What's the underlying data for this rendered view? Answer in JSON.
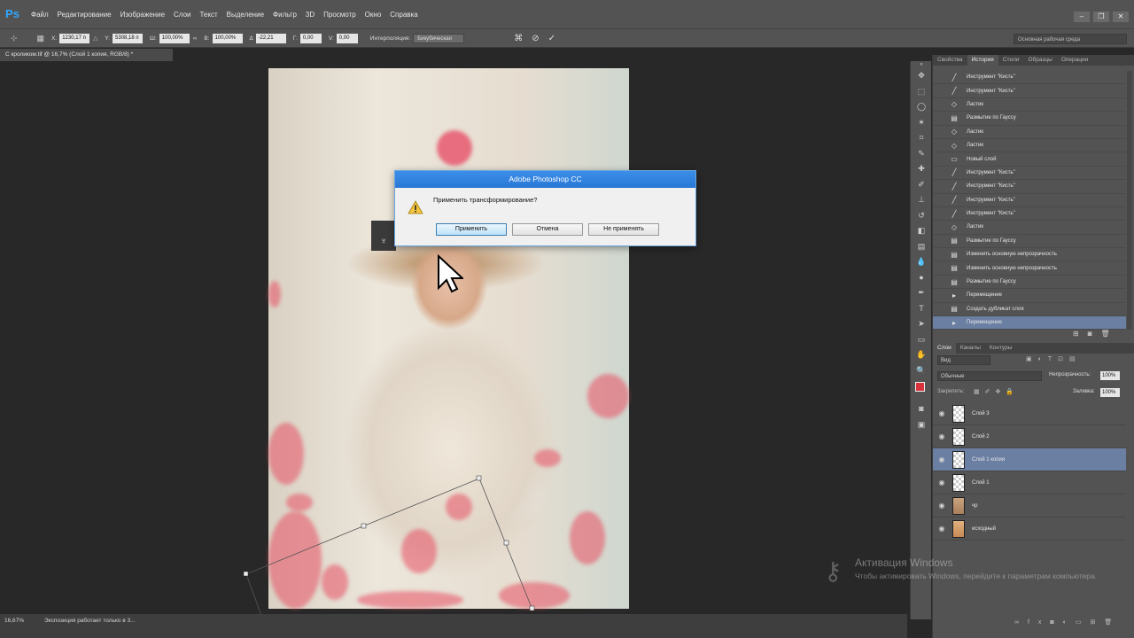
{
  "app": {
    "logo": "Ps",
    "workspace": "Основная рабочая среда"
  },
  "menu": [
    "Файл",
    "Редактирование",
    "Изображение",
    "Слои",
    "Текст",
    "Выделение",
    "Фильтр",
    "3D",
    "Просмотр",
    "Окно",
    "Справка"
  ],
  "options": {
    "x_label": "X:",
    "x_value": "1230,17 п",
    "y_label": "Y:",
    "y_value": "5308,18 п",
    "w_label": "Ш:",
    "w_value": "100,00%",
    "h_label": "В:",
    "h_value": "100,00%",
    "angle_label": "∆",
    "angle_value": "-22,21",
    "hskew_label": "Г:",
    "hskew_value": "0,00",
    "vskew_label": "V:",
    "vskew_value": "0,00",
    "interp_label": "Интерполяция:",
    "interp_value": "Бикубическая"
  },
  "document_tab": "С кроликом.tif @ 16,7% (Слой 1 копия, RGB/8) *",
  "dialog": {
    "title": "Adobe Photoshop CC",
    "message": "Применить трансформирование?",
    "apply": "Применить",
    "cancel": "Отмена",
    "dont_apply": "Не применять"
  },
  "panel_tabs_top": [
    "Свойства",
    "История",
    "Стили",
    "Образцы",
    "Операции"
  ],
  "history": [
    {
      "icon": "brush-icon",
      "label": "Инструмент \"Кисть\""
    },
    {
      "icon": "brush-icon",
      "label": "Инструмент \"Кисть\""
    },
    {
      "icon": "eraser-icon",
      "label": "Ластик"
    },
    {
      "icon": "filter-icon",
      "label": "Размытие по Гауссу"
    },
    {
      "icon": "eraser-icon",
      "label": "Ластик"
    },
    {
      "icon": "eraser-icon",
      "label": "Ластик"
    },
    {
      "icon": "layer-icon",
      "label": "Новый слой"
    },
    {
      "icon": "brush-icon",
      "label": "Инструмент \"Кисть\""
    },
    {
      "icon": "brush-icon",
      "label": "Инструмент \"Кисть\""
    },
    {
      "icon": "brush-icon",
      "label": "Инструмент \"Кисть\""
    },
    {
      "icon": "brush-icon",
      "label": "Инструмент \"Кисть\""
    },
    {
      "icon": "eraser-icon",
      "label": "Ластик"
    },
    {
      "icon": "filter-icon",
      "label": "Размытие по Гауссу"
    },
    {
      "icon": "filter-icon",
      "label": "Изменить основную непрозрачность"
    },
    {
      "icon": "filter-icon",
      "label": "Изменить основную непрозрачность"
    },
    {
      "icon": "filter-icon",
      "label": "Размытие по Гауссу"
    },
    {
      "icon": "move-icon",
      "label": "Перемещение"
    },
    {
      "icon": "filter-icon",
      "label": "Создать дубликат слоя"
    },
    {
      "icon": "move-icon",
      "label": "Перемещение"
    }
  ],
  "panel_tabs_layers": [
    "Слои",
    "Каналы",
    "Контуры"
  ],
  "layers_panel": {
    "kind": "Вид",
    "blend_mode": "Обычные",
    "opacity_label": "Непрозрачность:",
    "opacity_value": "100%",
    "lock_label": "Закрепить:",
    "fill_label": "Заливка:",
    "fill_value": "100%"
  },
  "layers": [
    {
      "name": "Слой 3",
      "thumb": "transparent"
    },
    {
      "name": "Слой 2",
      "thumb": "transparent"
    },
    {
      "name": "Слой 1 копия",
      "thumb": "transparent"
    },
    {
      "name": "Слой 1",
      "thumb": "transparent"
    },
    {
      "name": "чр",
      "thumb": "photo"
    },
    {
      "name": "исходный",
      "thumb": "photo2"
    }
  ],
  "status": {
    "zoom": "16,67%",
    "info": "Экспозиция работает только в 3..."
  },
  "activation": {
    "title": "Активация Windows",
    "subtitle": "Чтобы активировать Windows, перейдите к параметрам компьютера."
  },
  "colors": {
    "accent": "#6b7fa3",
    "brand": "#31a8ff",
    "petal": "#e75064"
  }
}
